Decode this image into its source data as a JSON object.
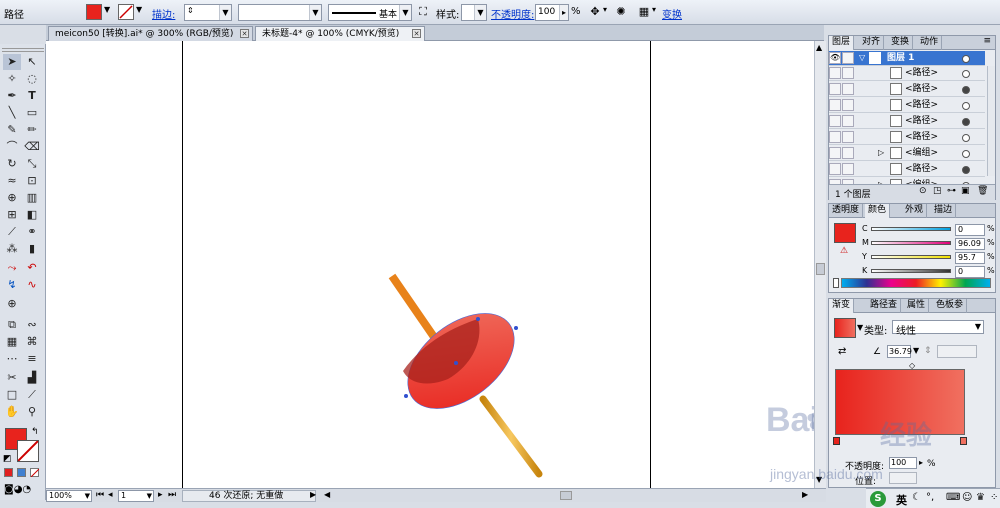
{
  "control_bar": {
    "object_label": "路径",
    "fill_color": "#e8231d",
    "stroke_label": "描边:",
    "stroke_style_label": "基本",
    "style_label": "样式:",
    "opacity_label": "不透明度:",
    "opacity_value": "100",
    "opacity_unit": "%",
    "transform_label": "变换"
  },
  "tabs": [
    {
      "label": "meicon50 [转换].ai* @ 300% (RGB/预览)",
      "active": false
    },
    {
      "label": "未标题-4* @ 100% (CMYK/预览)",
      "active": true
    }
  ],
  "status_bar": {
    "zoom": "100%",
    "artboard": "1",
    "message": "46 次还原; 无重做"
  },
  "layers_panel": {
    "tabs": [
      "图层",
      "对齐",
      "变换",
      "动作"
    ],
    "top_layer": "图层 1",
    "rows": [
      {
        "name": "<路径>",
        "target": "empty",
        "expand": false
      },
      {
        "name": "<路径>",
        "target": "filled",
        "expand": false
      },
      {
        "name": "<路径>",
        "target": "empty",
        "expand": false
      },
      {
        "name": "<路径>",
        "target": "filled",
        "expand": false
      },
      {
        "name": "<路径>",
        "target": "empty",
        "expand": false
      },
      {
        "name": "<编组>",
        "target": "empty",
        "expand": true
      },
      {
        "name": "<路径>",
        "target": "filled",
        "expand": false
      },
      {
        "name": "<编组>",
        "target": "empty",
        "expand": true
      }
    ],
    "footer": "1 个图层"
  },
  "color_panel": {
    "tabs": [
      "透明度",
      "颜色",
      "外观",
      "描边"
    ],
    "swatch": "#e8231d",
    "channels": [
      {
        "name": "C",
        "value": "0",
        "color": "#00a0e0"
      },
      {
        "name": "M",
        "value": "96.09",
        "color": "#e0007a"
      },
      {
        "name": "Y",
        "value": "95.7",
        "color": "#f0e000"
      },
      {
        "name": "K",
        "value": "0",
        "color": "#333333"
      }
    ]
  },
  "gradient_panel": {
    "tabs": [
      "渐变",
      "路径查",
      "属性",
      "色板参"
    ],
    "type_label": "类型:",
    "type_value": "线性",
    "angle_value": "36.79",
    "opacity_label": "不透明度:",
    "opacity_value": "100",
    "opacity_unit": "%",
    "location_label": "位置:",
    "start_color": "#e8231d",
    "end_color": "#f07060"
  },
  "watermark": {
    "brand_cn": "经验",
    "url": "jingyan.baidu.com"
  },
  "ime": {
    "lang": "英"
  }
}
